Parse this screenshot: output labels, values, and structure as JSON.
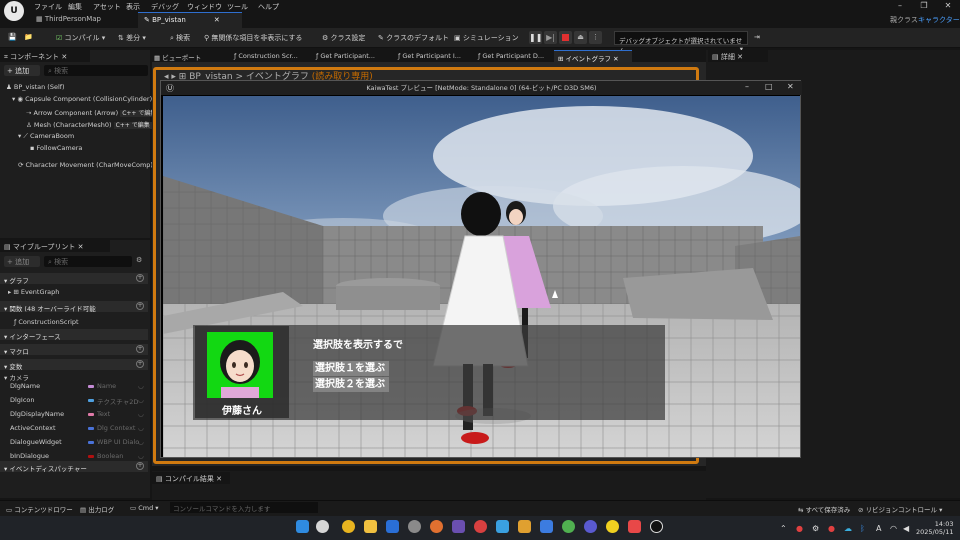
{
  "menubar": {
    "items": [
      "ファイル",
      "編集",
      "アセット",
      "表示",
      "デバッグ",
      "ウィンドウ",
      "ツール",
      "ヘルプ"
    ]
  },
  "tabs": [
    "ThirdPersonMap",
    "BP_vistan"
  ],
  "top_right": {
    "parent_class": "親クラス",
    "class_name": "キャラクター"
  },
  "toolbar": {
    "compile": "コンパイル",
    "diff": "差分",
    "search": "検索",
    "hide_unrelated": "無関係な項目を非表示にする",
    "class_settings": "クラス設定",
    "class_defaults": "クラスのデフォルト",
    "simulation": "シミュレーション",
    "debug_object": "デバッグオブジェクトが選択されていません"
  },
  "components": {
    "tab": "コンポーネント",
    "add": "+ 追加",
    "search_placeholder": "検索",
    "items": [
      "BP_vistan (Self)",
      "Capsule Component (CollisionCylinder)",
      "Arrow Component (Arrow)",
      "Mesh (CharacterMesh0)",
      "CameraBoom",
      "FollowCamera",
      "Character Movement (CharMoveComp)"
    ],
    "edit_cpp": "C++ で編集"
  },
  "mybp": {
    "tab": "マイブループリント",
    "add": "+ 追加",
    "search_placeholder": "検索",
    "graphs": "グラフ",
    "event_graph": "EventGraph",
    "functions": "関数 (48 オーバーライド可能",
    "construction": "ConstructionScript",
    "interfaces": "インターフェース",
    "macros": "マクロ",
    "variables": "変数",
    "camera": "カメラ",
    "vars": [
      {
        "name": "DlgName",
        "type": "Name",
        "color": "#c58cd6"
      },
      {
        "name": "DlgIcon",
        "type": "テクスチャ2D",
        "color": "#4fa0e0"
      },
      {
        "name": "DlgDisplayName",
        "type": "Text",
        "color": "#e07aa8"
      },
      {
        "name": "ActiveContext",
        "type": "Dlg Context",
        "color": "#4a72d8"
      },
      {
        "name": "DialogueWidget",
        "type": "WBP UI Dialo",
        "color": "#4a72d8"
      },
      {
        "name": "bInDialogue",
        "type": "Boolean",
        "color": "#b01010"
      }
    ],
    "dispatchers": "イベントディスパッチャー"
  },
  "graph_tabs": [
    "ビューポート",
    "Construction Scr...",
    "Get Participant...",
    "Get Participant I...",
    "Get Participant D...",
    "イベントグラフ"
  ],
  "graph_header": {
    "bp": "BP_vistan",
    "sep": ">",
    "graph": "イベントグラフ",
    "readonly": "(読み取り専用)"
  },
  "details_tab": "詳細",
  "preview": {
    "title": "KaiwaTest プレビュー [NetMode: Standalone 0]  (64-ビット/PC D3D SM6)"
  },
  "dialogue": {
    "speaker": "伊藤さん",
    "text": "選択肢を表示するで",
    "choices": [
      "選択肢１を選ぶ",
      "選択肢２を選ぶ"
    ]
  },
  "compile_results": "コンパイル結果",
  "statusbar": {
    "content_drawer": "コンテンツドロワー",
    "output_log": "出力ログ",
    "cmd": "Cmd",
    "cmd_placeholder": "コンソールコマンドを入力します",
    "save_all": "すべて保存済み",
    "revision": "リビジョンコントロール"
  },
  "clock": {
    "time": "14:03",
    "date": "2025/05/11"
  }
}
